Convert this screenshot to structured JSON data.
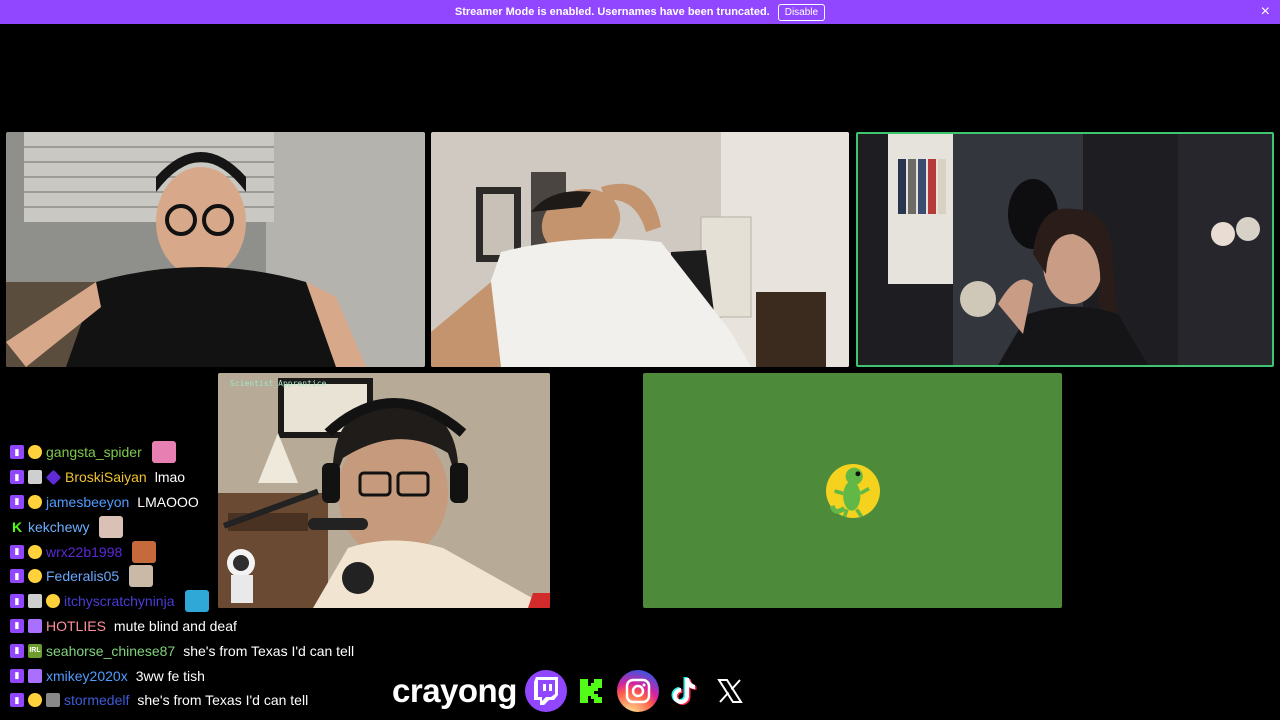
{
  "banner": {
    "text": "Streamer Mode is enabled. Usernames have been truncated.",
    "button_label": "Disable",
    "close_glyph": "×",
    "color": "#9147ff"
  },
  "tiles": {
    "tile4_label": "Scientist_Apprentice",
    "speaking_border_color": "#3fc46f",
    "avatar_bg_color": "#4d8a3a"
  },
  "chat": [
    {
      "badges": [
        "twitch",
        "emoji"
      ],
      "username": "gangsta_spider",
      "color": "#7ec94b",
      "message": "",
      "emote": "#e77fb3"
    },
    {
      "badges": [
        "twitch",
        "sub",
        "prime"
      ],
      "username": "BroskiSaiyan",
      "color": "#f1c232",
      "message": "lmao",
      "emote": ""
    },
    {
      "badges": [
        "twitch",
        "emoji"
      ],
      "username": "jamesbeeyon",
      "color": "#4f9cff",
      "message": "LMAOOO",
      "emote": ""
    },
    {
      "badges": [
        "kick"
      ],
      "username": "kekchewy",
      "color": "#6ab0ff",
      "message": "",
      "emote": "#d9c2b5"
    },
    {
      "badges": [
        "twitch",
        "emoji"
      ],
      "username": "wrx22b1998",
      "color": "#5b2ad6",
      "message": "",
      "emote": "#c56b3b"
    },
    {
      "badges": [
        "twitch",
        "emoji"
      ],
      "username": "Federalis05",
      "color": "#6aa8ff",
      "message": "",
      "emote": "#c9b9a6"
    },
    {
      "badges": [
        "twitch",
        "sub",
        "emoji"
      ],
      "username": "itchyscratchyninja",
      "color": "#4a3cd6",
      "message": "",
      "emote": "#2fa8d8"
    },
    {
      "badges": [
        "twitch",
        "gift"
      ],
      "username": "HOTLIES",
      "color": "#ff8f9c",
      "message": "mute blind and deaf",
      "emote": ""
    },
    {
      "badges": [
        "twitch",
        "irl"
      ],
      "username": "seahorse_chinese87",
      "color": "#7fd47a",
      "message": "she's from Texas I'd can tell",
      "emote": ""
    },
    {
      "badges": [
        "twitch",
        "gift"
      ],
      "username": "xmikey2020x",
      "color": "#4f9cff",
      "message": "3ww fe tish",
      "emote": ""
    },
    {
      "badges": [
        "twitch",
        "emoji",
        "mute"
      ],
      "username": "stormedelf",
      "color": "#3e5bd6",
      "message": "she's from Texas I'd can tell",
      "emote": ""
    }
  ],
  "footer": {
    "brand_name": "crayong",
    "socials": [
      "twitch-icon",
      "kick-icon",
      "instagram-icon",
      "tiktok-icon",
      "x-icon"
    ]
  }
}
